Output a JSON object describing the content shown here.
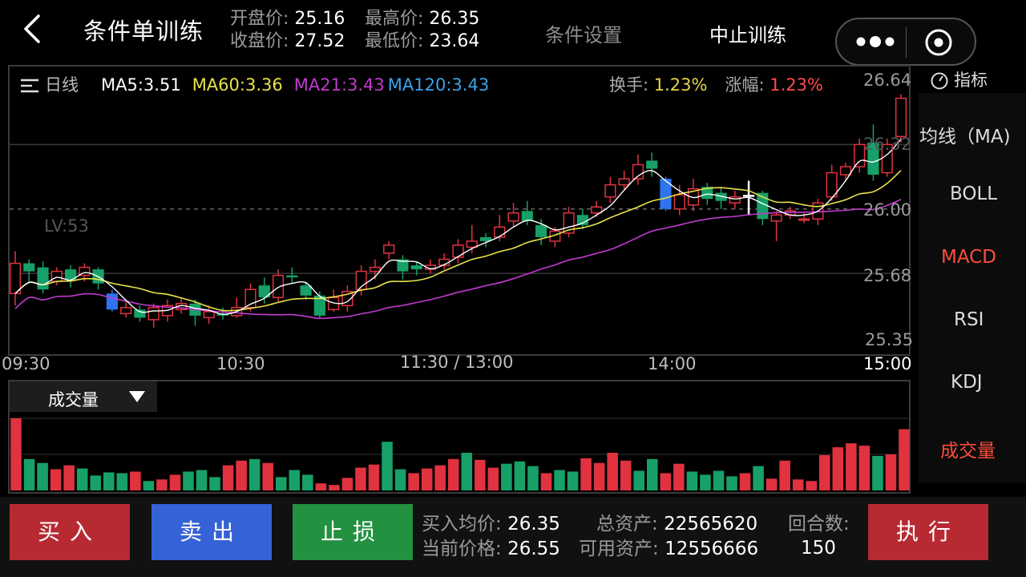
{
  "header": {
    "title": "条件单训练",
    "open_label": "开盘价",
    "open_value": "25.16",
    "high_label": "最高价",
    "high_value": "26.35",
    "close_label": "收盘价",
    "close_value": "27.52",
    "low_label": "最低价",
    "low_value": "23.64",
    "condition_settings": "条件设置",
    "stop_training": "中止训练"
  },
  "chart": {
    "period": "日线",
    "ma5": "MA5:3.51",
    "ma60": "MA60:3.36",
    "ma21": "MA21:3.43",
    "ma120": "MA120:3.43",
    "turnover_label": "换手",
    "turnover_value": "1.23%",
    "change_label": "涨幅",
    "change_value": "1.23%",
    "lv": "LV:53",
    "y_ticks": [
      "26.64",
      "26.32",
      "26.00",
      "25.68",
      "25.35"
    ],
    "x_ticks": [
      "09:30",
      "10:30",
      "11:30 / 13:00",
      "14:00",
      "15:00"
    ]
  },
  "volume": {
    "tab_label": "成交量"
  },
  "indicators": {
    "header": "指标",
    "items": [
      {
        "label": "均线（MA)",
        "color": "#dddddd"
      },
      {
        "label": "BOLL",
        "color": "#dddddd"
      },
      {
        "label": "MACD",
        "color": "#ff4c3c"
      },
      {
        "label": "RSI",
        "color": "#dddddd"
      },
      {
        "label": "KDJ",
        "color": "#dddddd"
      },
      {
        "label": "成交量",
        "color": "#ff4c3c"
      }
    ]
  },
  "trade": {
    "buy": "买入",
    "sell": "卖出",
    "stop_loss": "止损",
    "execute": "执行",
    "avg_buy_label": "买入均价",
    "avg_buy_value": "26.35",
    "current_label": "当前价格",
    "current_value": "26.55",
    "total_assets_label": "总资产",
    "total_assets_value": "22565620",
    "available_label": "可用资产",
    "available_value": "12556666",
    "rounds_label": "回合数:",
    "rounds_value": "150"
  },
  "colors": {
    "up": "#e0323f",
    "down": "#17a067",
    "highlight_blue": "#2f74ee",
    "ma5": "#ffffff",
    "ma60": "#e8e24a",
    "ma21": "#c13ad0",
    "ma120": "#3aa4ea"
  },
  "chart_data": {
    "type": "candlestick",
    "ylim": [
      25.35,
      26.64
    ],
    "candles": [
      {
        "o": 25.73,
        "c": 25.58,
        "h": 25.79,
        "l": 25.52,
        "up": true
      },
      {
        "o": 25.73,
        "c": 25.69,
        "h": 25.75,
        "l": 25.63,
        "up": false
      },
      {
        "o": 25.71,
        "c": 25.6,
        "h": 25.74,
        "l": 25.58,
        "up": false
      },
      {
        "o": 25.64,
        "c": 25.69,
        "h": 25.71,
        "l": 25.62,
        "up": true
      },
      {
        "o": 25.7,
        "c": 25.65,
        "h": 25.72,
        "l": 25.61,
        "up": false
      },
      {
        "o": 25.67,
        "c": 25.71,
        "h": 25.73,
        "l": 25.64,
        "up": true
      },
      {
        "o": 25.7,
        "c": 25.63,
        "h": 25.71,
        "l": 25.6,
        "up": false
      },
      {
        "o": 25.58,
        "c": 25.5,
        "h": 25.6,
        "l": 25.49,
        "up": false,
        "blue": true
      },
      {
        "o": 25.48,
        "c": 25.51,
        "h": 25.54,
        "l": 25.46,
        "up": true
      },
      {
        "o": 25.5,
        "c": 25.46,
        "h": 25.52,
        "l": 25.44,
        "up": false
      },
      {
        "o": 25.45,
        "c": 25.51,
        "h": 25.53,
        "l": 25.41,
        "up": true
      },
      {
        "o": 25.47,
        "c": 25.52,
        "h": 25.55,
        "l": 25.44,
        "up": true
      },
      {
        "o": 25.5,
        "c": 25.53,
        "h": 25.56,
        "l": 25.48,
        "up": true
      },
      {
        "o": 25.53,
        "c": 25.47,
        "h": 25.55,
        "l": 25.42,
        "up": false
      },
      {
        "o": 25.46,
        "c": 25.49,
        "h": 25.52,
        "l": 25.43,
        "up": true
      },
      {
        "o": 25.48,
        "c": 25.47,
        "h": 25.51,
        "l": 25.45,
        "up": false
      },
      {
        "o": 25.47,
        "c": 25.51,
        "h": 25.56,
        "l": 25.46,
        "up": true
      },
      {
        "o": 25.51,
        "c": 25.6,
        "h": 25.63,
        "l": 25.49,
        "up": true
      },
      {
        "o": 25.62,
        "c": 25.56,
        "h": 25.66,
        "l": 25.53,
        "up": false
      },
      {
        "o": 25.56,
        "c": 25.67,
        "h": 25.7,
        "l": 25.54,
        "up": true
      },
      {
        "o": 25.67,
        "c": 25.66,
        "h": 25.71,
        "l": 25.63,
        "up": false
      },
      {
        "o": 25.62,
        "c": 25.57,
        "h": 25.64,
        "l": 25.55,
        "up": false
      },
      {
        "o": 25.57,
        "c": 25.47,
        "h": 25.59,
        "l": 25.46,
        "up": false
      },
      {
        "o": 25.5,
        "c": 25.56,
        "h": 25.6,
        "l": 25.49,
        "up": true
      },
      {
        "o": 25.52,
        "c": 25.59,
        "h": 25.62,
        "l": 25.49,
        "up": true
      },
      {
        "o": 25.6,
        "c": 25.69,
        "h": 25.72,
        "l": 25.57,
        "up": true
      },
      {
        "o": 25.69,
        "c": 25.71,
        "h": 25.75,
        "l": 25.65,
        "up": true
      },
      {
        "o": 25.78,
        "c": 25.82,
        "h": 25.84,
        "l": 25.75,
        "up": true
      },
      {
        "o": 25.75,
        "c": 25.69,
        "h": 25.77,
        "l": 25.65,
        "up": false
      },
      {
        "o": 25.72,
        "c": 25.7,
        "h": 25.74,
        "l": 25.67,
        "up": false
      },
      {
        "o": 25.7,
        "c": 25.72,
        "h": 25.75,
        "l": 25.68,
        "up": true
      },
      {
        "o": 25.72,
        "c": 25.75,
        "h": 25.78,
        "l": 25.7,
        "up": true
      },
      {
        "o": 25.76,
        "c": 25.82,
        "h": 25.85,
        "l": 25.73,
        "up": true
      },
      {
        "o": 25.81,
        "c": 25.84,
        "h": 25.92,
        "l": 25.78,
        "up": true
      },
      {
        "o": 25.86,
        "c": 25.84,
        "h": 25.88,
        "l": 25.81,
        "up": false
      },
      {
        "o": 25.86,
        "c": 25.91,
        "h": 25.97,
        "l": 25.84,
        "up": true
      },
      {
        "o": 25.94,
        "c": 25.98,
        "h": 26.03,
        "l": 25.91,
        "up": true
      },
      {
        "o": 25.99,
        "c": 25.94,
        "h": 26.04,
        "l": 25.92,
        "up": false
      },
      {
        "o": 25.92,
        "c": 25.86,
        "h": 25.95,
        "l": 25.82,
        "up": false
      },
      {
        "o": 25.84,
        "c": 25.89,
        "h": 25.91,
        "l": 25.81,
        "up": true
      },
      {
        "o": 25.88,
        "c": 25.98,
        "h": 26.01,
        "l": 25.86,
        "up": true
      },
      {
        "o": 25.97,
        "c": 25.92,
        "h": 26.0,
        "l": 25.9,
        "up": false
      },
      {
        "o": 25.98,
        "c": 26.01,
        "h": 26.04,
        "l": 25.96,
        "up": true
      },
      {
        "o": 26.06,
        "c": 26.12,
        "h": 26.16,
        "l": 26.03,
        "up": true
      },
      {
        "o": 26.12,
        "c": 26.15,
        "h": 26.19,
        "l": 26.09,
        "up": true
      },
      {
        "o": 26.15,
        "c": 26.22,
        "h": 26.27,
        "l": 26.12,
        "up": true
      },
      {
        "o": 26.24,
        "c": 26.2,
        "h": 26.28,
        "l": 26.16,
        "up": false
      },
      {
        "o": 26.15,
        "c": 26.0,
        "h": 26.16,
        "l": 25.99,
        "up": false,
        "blue": true
      },
      {
        "o": 26.0,
        "c": 26.07,
        "h": 26.12,
        "l": 25.97,
        "up": true
      },
      {
        "o": 26.02,
        "c": 26.1,
        "h": 26.15,
        "l": 25.99,
        "up": true
      },
      {
        "o": 26.11,
        "c": 26.05,
        "h": 26.13,
        "l": 26.02,
        "up": false
      },
      {
        "o": 26.08,
        "c": 26.04,
        "h": 26.11,
        "l": 26.0,
        "up": false
      },
      {
        "o": 26.03,
        "c": 26.06,
        "h": 26.09,
        "l": 26.0,
        "up": true
      },
      {
        "o": 26.07,
        "c": 26.07,
        "h": 26.14,
        "l": 25.97,
        "up": true,
        "doji": true
      },
      {
        "o": 26.08,
        "c": 25.95,
        "h": 26.09,
        "l": 25.92,
        "up": false
      },
      {
        "o": 25.94,
        "c": 25.97,
        "h": 25.99,
        "l": 25.84,
        "up": true
      },
      {
        "o": 25.97,
        "c": 25.99,
        "h": 26.01,
        "l": 25.95,
        "up": true
      },
      {
        "o": 25.95,
        "c": 25.95,
        "h": 25.98,
        "l": 25.93,
        "up": true
      },
      {
        "o": 25.95,
        "c": 26.03,
        "h": 26.05,
        "l": 25.92,
        "up": true
      },
      {
        "o": 26.06,
        "c": 26.18,
        "h": 26.22,
        "l": 26.04,
        "up": true
      },
      {
        "o": 26.17,
        "c": 26.21,
        "h": 26.23,
        "l": 26.14,
        "up": true
      },
      {
        "o": 26.21,
        "c": 26.32,
        "h": 26.35,
        "l": 26.18,
        "up": true
      },
      {
        "o": 26.33,
        "c": 26.17,
        "h": 26.42,
        "l": 26.14,
        "up": false
      },
      {
        "o": 26.18,
        "c": 26.32,
        "h": 26.35,
        "l": 26.16,
        "up": true
      },
      {
        "o": 26.36,
        "c": 26.55,
        "h": 26.57,
        "l": 26.33,
        "up": true
      }
    ],
    "volume": [
      {
        "v": 92,
        "up": true
      },
      {
        "v": 40,
        "up": false
      },
      {
        "v": 35,
        "up": false
      },
      {
        "v": 27,
        "up": true
      },
      {
        "v": 32,
        "up": true
      },
      {
        "v": 28,
        "up": false
      },
      {
        "v": 19,
        "up": false
      },
      {
        "v": 23,
        "up": false
      },
      {
        "v": 22,
        "up": false
      },
      {
        "v": 24,
        "up": true
      },
      {
        "v": 12,
        "up": false
      },
      {
        "v": 14,
        "up": true
      },
      {
        "v": 20,
        "up": true
      },
      {
        "v": 24,
        "up": false
      },
      {
        "v": 26,
        "up": false
      },
      {
        "v": 17,
        "up": false
      },
      {
        "v": 32,
        "up": true
      },
      {
        "v": 38,
        "up": true
      },
      {
        "v": 40,
        "up": false
      },
      {
        "v": 35,
        "up": true
      },
      {
        "v": 17,
        "up": false
      },
      {
        "v": 26,
        "up": false
      },
      {
        "v": 20,
        "up": false
      },
      {
        "v": 9,
        "up": true
      },
      {
        "v": 7,
        "up": true
      },
      {
        "v": 16,
        "up": true
      },
      {
        "v": 29,
        "up": true
      },
      {
        "v": 33,
        "up": true
      },
      {
        "v": 62,
        "up": false
      },
      {
        "v": 27,
        "up": false
      },
      {
        "v": 22,
        "up": true
      },
      {
        "v": 28,
        "up": true
      },
      {
        "v": 32,
        "up": true
      },
      {
        "v": 40,
        "up": true
      },
      {
        "v": 48,
        "up": false
      },
      {
        "v": 39,
        "up": true
      },
      {
        "v": 29,
        "up": true
      },
      {
        "v": 34,
        "up": false
      },
      {
        "v": 37,
        "up": false
      },
      {
        "v": 31,
        "up": false
      },
      {
        "v": 22,
        "up": true
      },
      {
        "v": 26,
        "up": false
      },
      {
        "v": 24,
        "up": false
      },
      {
        "v": 41,
        "up": true
      },
      {
        "v": 35,
        "up": true
      },
      {
        "v": 48,
        "up": true
      },
      {
        "v": 38,
        "up": true
      },
      {
        "v": 25,
        "up": false
      },
      {
        "v": 40,
        "up": false
      },
      {
        "v": 22,
        "up": true
      },
      {
        "v": 34,
        "up": true
      },
      {
        "v": 24,
        "up": false
      },
      {
        "v": 20,
        "up": false
      },
      {
        "v": 25,
        "up": false
      },
      {
        "v": 18,
        "up": false
      },
      {
        "v": 22,
        "up": true
      },
      {
        "v": 31,
        "up": false
      },
      {
        "v": 15,
        "up": true
      },
      {
        "v": 38,
        "up": true
      },
      {
        "v": 14,
        "up": true
      },
      {
        "v": 12,
        "up": true
      },
      {
        "v": 45,
        "up": true
      },
      {
        "v": 55,
        "up": true
      },
      {
        "v": 60,
        "up": true
      },
      {
        "v": 57,
        "up": true
      },
      {
        "v": 44,
        "up": false
      },
      {
        "v": 46,
        "up": true
      },
      {
        "v": 78,
        "up": true
      }
    ]
  }
}
